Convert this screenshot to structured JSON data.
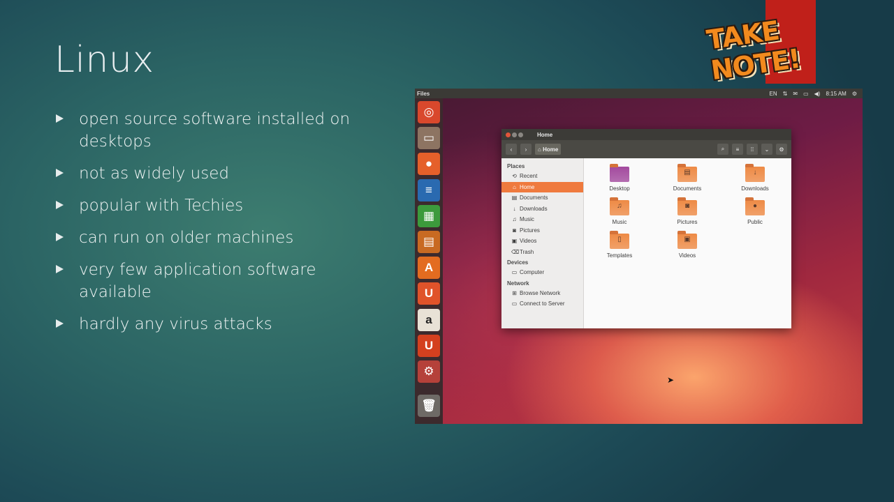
{
  "slide": {
    "title": "Linux",
    "bullets": [
      "open source software installed on desktops",
      "not as widely used",
      "popular with Techies",
      "can run on older machines",
      "very few application software available",
      "hardly any virus attacks"
    ],
    "badge_text": "TAKE NOTE!"
  },
  "screenshot": {
    "topbar": {
      "app_name": "Files",
      "keyboard": "EN",
      "clock": "8:15 AM",
      "icons": [
        "keyboard-icon",
        "network-icon",
        "mail-icon",
        "battery-icon",
        "volume-icon",
        "power-icon"
      ]
    },
    "launcher": [
      {
        "name": "ubuntu-dash-icon",
        "glyph": "◎",
        "color": "#d9482c"
      },
      {
        "name": "files-icon",
        "glyph": "▭",
        "color": "#8d7462"
      },
      {
        "name": "firefox-icon",
        "glyph": "●",
        "color": "#e5602a"
      },
      {
        "name": "writer-icon",
        "glyph": "≡",
        "color": "#2a6ab0"
      },
      {
        "name": "calc-icon",
        "glyph": "▦",
        "color": "#3c9a3c"
      },
      {
        "name": "impress-icon",
        "glyph": "▤",
        "color": "#c86a22"
      },
      {
        "name": "software-center-icon",
        "glyph": "A",
        "color": "#e36c20"
      },
      {
        "name": "ubuntu-one-icon",
        "glyph": "U",
        "color": "#e0532a"
      },
      {
        "name": "amazon-icon",
        "glyph": "a",
        "color": "#e8e2d6"
      },
      {
        "name": "ubuntu-one-music-icon",
        "glyph": "U",
        "color": "#d4401f"
      },
      {
        "name": "system-settings-icon",
        "glyph": "⚙",
        "color": "#b5413a"
      },
      {
        "name": "trash-icon",
        "glyph": "🗑",
        "color": "#6e6a66"
      }
    ],
    "window": {
      "title": "Home",
      "location_button": "Home",
      "sidebar": [
        {
          "heading": "Places",
          "items": [
            {
              "label": "Recent",
              "icon": "⟲",
              "active": false
            },
            {
              "label": "Home",
              "icon": "⌂",
              "active": true
            },
            {
              "label": "Documents",
              "icon": "▤",
              "active": false
            },
            {
              "label": "Downloads",
              "icon": "↓",
              "active": false
            },
            {
              "label": "Music",
              "icon": "♫",
              "active": false
            },
            {
              "label": "Pictures",
              "icon": "◙",
              "active": false
            },
            {
              "label": "Videos",
              "icon": "▣",
              "active": false
            },
            {
              "label": "Trash",
              "icon": "⌫",
              "active": false
            }
          ]
        },
        {
          "heading": "Devices",
          "items": [
            {
              "label": "Computer",
              "icon": "▭",
              "active": false
            }
          ]
        },
        {
          "heading": "Network",
          "items": [
            {
              "label": "Browse Network",
              "icon": "⊞",
              "active": false
            },
            {
              "label": "Connect to Server",
              "icon": "▭",
              "active": false
            }
          ]
        }
      ],
      "files": [
        {
          "label": "Desktop",
          "glyph": "",
          "color": "#a34a9e"
        },
        {
          "label": "Documents",
          "glyph": "▤",
          "color": "#ee8a45"
        },
        {
          "label": "Downloads",
          "glyph": "↓",
          "color": "#ee8a45"
        },
        {
          "label": "Music",
          "glyph": "♫",
          "color": "#ee8a45"
        },
        {
          "label": "Pictures",
          "glyph": "◙",
          "color": "#ee8a45"
        },
        {
          "label": "Public",
          "glyph": "●",
          "color": "#ee8a45"
        },
        {
          "label": "Templates",
          "glyph": "▯",
          "color": "#ee8a45"
        },
        {
          "label": "Videos",
          "glyph": "▣",
          "color": "#ee8a45"
        }
      ]
    }
  }
}
